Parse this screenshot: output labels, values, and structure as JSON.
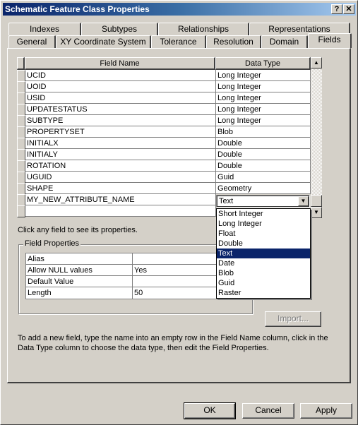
{
  "window": {
    "title": "Schematic Feature Class Properties",
    "help_button": "?",
    "close_button": "✕"
  },
  "tabs": {
    "row_back": [
      {
        "label": "Indexes"
      },
      {
        "label": "Subtypes"
      },
      {
        "label": "Relationships"
      },
      {
        "label": "Representations"
      }
    ],
    "row_front": [
      {
        "label": "General"
      },
      {
        "label": "XY Coordinate System"
      },
      {
        "label": "Tolerance"
      },
      {
        "label": "Resolution"
      },
      {
        "label": "Domain"
      },
      {
        "label": "Fields",
        "active": true
      }
    ]
  },
  "fields_grid": {
    "columns": [
      "Field Name",
      "Data Type"
    ],
    "rows": [
      {
        "name": "UCID",
        "type": "Long Integer"
      },
      {
        "name": "UOID",
        "type": "Long Integer"
      },
      {
        "name": "USID",
        "type": "Long Integer"
      },
      {
        "name": "UPDATESTATUS",
        "type": "Long Integer"
      },
      {
        "name": "SUBTYPE",
        "type": "Long Integer"
      },
      {
        "name": "PROPERTYSET",
        "type": "Blob"
      },
      {
        "name": "INITIALX",
        "type": "Double"
      },
      {
        "name": "INITIALY",
        "type": "Double"
      },
      {
        "name": "ROTATION",
        "type": "Double"
      },
      {
        "name": "UGUID",
        "type": "Guid"
      },
      {
        "name": "SHAPE",
        "type": "Geometry"
      },
      {
        "name": "MY_NEW_ATTRIBUTE_NAME",
        "type": "Text"
      },
      {
        "name": "",
        "type": ""
      }
    ],
    "editing_type_value": "Text",
    "type_options": [
      "Short Integer",
      "Long Integer",
      "Float",
      "Double",
      "Text",
      "Date",
      "Blob",
      "Guid",
      "Raster"
    ],
    "selected_option": "Text"
  },
  "hint": "Click any field to see its properties.",
  "field_properties": {
    "legend": "Field Properties",
    "rows": [
      {
        "key": "Alias",
        "value": ""
      },
      {
        "key": "Allow NULL values",
        "value": "Yes"
      },
      {
        "key": "Default Value",
        "value": ""
      },
      {
        "key": "Length",
        "value": "50"
      }
    ]
  },
  "import_button": "Import...",
  "footnote": "To add a new field, type the name into an empty row in the Field Name column, click in the Data Type column to choose the data type, then edit the Field Properties.",
  "buttons": {
    "ok": "OK",
    "cancel": "Cancel",
    "apply": "Apply"
  }
}
